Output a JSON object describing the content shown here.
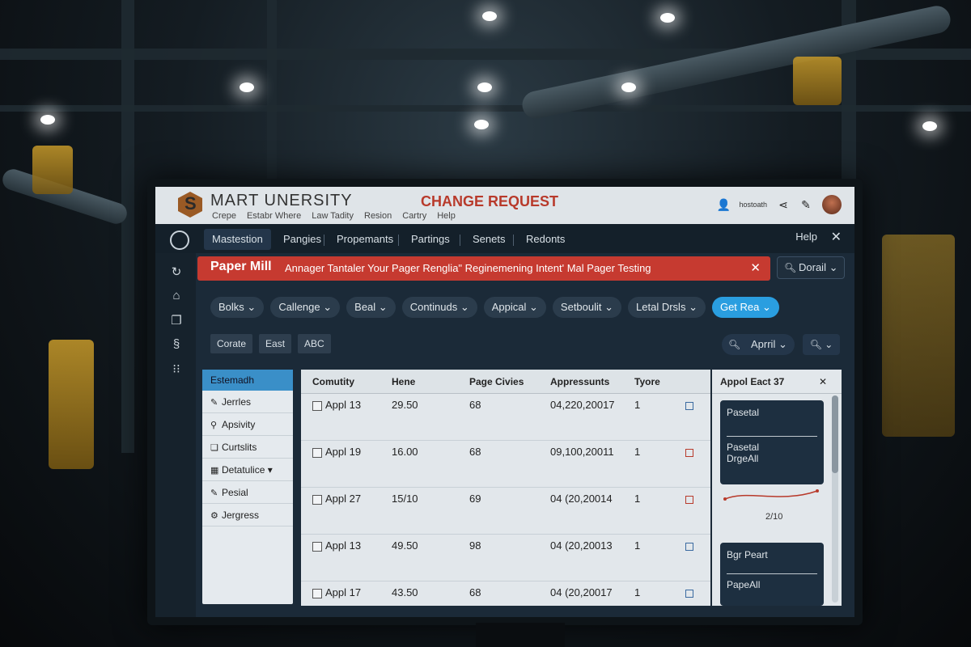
{
  "header": {
    "logo_letter": "S",
    "app_title": "MART UNERSITY",
    "menu": [
      "Crepe",
      "Estabr Where",
      "Law Tadity",
      "Resion",
      "Cartry",
      "Help"
    ],
    "request_title": "CHANGE REQUEST",
    "user_label": "hostoath"
  },
  "tabs": [
    "Mastestion",
    "Pangies",
    "Propemants",
    "Partings",
    "Senets",
    "Redonts"
  ],
  "tabs_right": {
    "help": "Help",
    "close": "✕"
  },
  "banner": {
    "title": "Paper Mill",
    "message": "Annager Tantaler Your Pager Renglia\" Reginemening Intent' Mal Pager Testing",
    "close": "✕"
  },
  "top_search": {
    "label": "Dorail"
  },
  "filter_chips": [
    "Bolks",
    "Callenge",
    "Beal",
    "Continuds",
    "Appical",
    "Setboulit",
    "Letal Drsls",
    "Get Rea"
  ],
  "action_buttons": [
    "Corate",
    "East",
    "ABC"
  ],
  "month_search": {
    "label": "Aprril"
  },
  "left_nav": {
    "header": "Estemadh",
    "items": [
      {
        "icon": "pencil-icon",
        "label": "Jerrles"
      },
      {
        "icon": "wrench-icon",
        "label": "Apsivity"
      },
      {
        "icon": "doc-icon",
        "label": "Curtslits"
      },
      {
        "icon": "table-icon",
        "label": "Detatulice"
      },
      {
        "icon": "pencil-icon",
        "label": "Pesial"
      },
      {
        "icon": "gear-icon",
        "label": "Jergress"
      }
    ]
  },
  "table": {
    "columns": [
      "Comutity",
      "Hene",
      "Page Civies",
      "Appressunts",
      "Tyore"
    ],
    "rows": [
      {
        "name": "Appl 13",
        "hene": "29.50",
        "pages": "68",
        "date": "04,220,20017",
        "type": "1",
        "mark": "blue"
      },
      {
        "name": "Appl 19",
        "hene": "16.00",
        "pages": "68",
        "date": "09,100,20011",
        "type": "1",
        "mark": "red"
      },
      {
        "name": "Appl 27",
        "hene": "15/10",
        "pages": "69",
        "date": "04 (20,20014",
        "type": "1",
        "mark": "red"
      },
      {
        "name": "Appl 13",
        "hene": "49.50",
        "pages": "98",
        "date": "04 (20,20013",
        "type": "1",
        "mark": "blue"
      },
      {
        "name": "Appl 17",
        "hene": "43.50",
        "pages": "68",
        "date": "04 (20,20017",
        "type": "1",
        "mark": "blue"
      }
    ]
  },
  "right_panel": {
    "header": "Appol Eact 37",
    "card1": {
      "line1": "Pasetal",
      "line2": "Pasetal",
      "line3": "DrgeAll"
    },
    "trend_value": "2/10",
    "card2": {
      "line1": "Bgr Peart",
      "line2": "PapeAll"
    }
  }
}
